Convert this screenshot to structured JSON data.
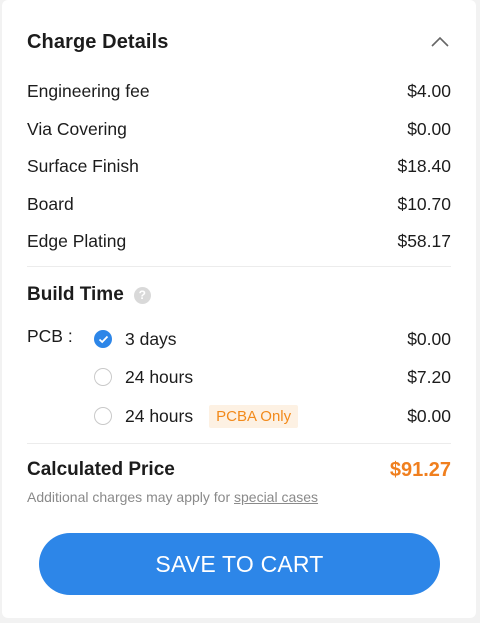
{
  "charge_details": {
    "title": "Charge Details",
    "items": [
      {
        "label": "Engineering fee",
        "value": "$4.00"
      },
      {
        "label": "Via Covering",
        "value": "$0.00"
      },
      {
        "label": "Surface Finish",
        "value": "$18.40"
      },
      {
        "label": "Board",
        "value": "$10.70"
      },
      {
        "label": "Edge Plating",
        "value": "$58.17"
      }
    ]
  },
  "build_time": {
    "title": "Build Time",
    "pcb_label": "PCB :",
    "options": [
      {
        "label": "3 days",
        "price": "$0.00",
        "selected": true
      },
      {
        "label": "24 hours",
        "price": "$7.20",
        "selected": false
      },
      {
        "label": "24 hours",
        "price": "$0.00",
        "selected": false,
        "badge": "PCBA Only"
      }
    ]
  },
  "calculated": {
    "title": "Calculated Price",
    "value": "$91.27",
    "note_prefix": "Additional charges may apply for",
    "note_link": "special cases"
  },
  "save_button": {
    "label": "SAVE TO CART"
  },
  "colors": {
    "accent": "#2d86e8",
    "price_orange": "#f07f1e",
    "badge_bg": "#fdf1e3",
    "badge_text": "#f28a1b"
  },
  "icons": {
    "collapse": "chevron-up-icon",
    "help": "help-circle-icon",
    "check": "check-icon"
  }
}
